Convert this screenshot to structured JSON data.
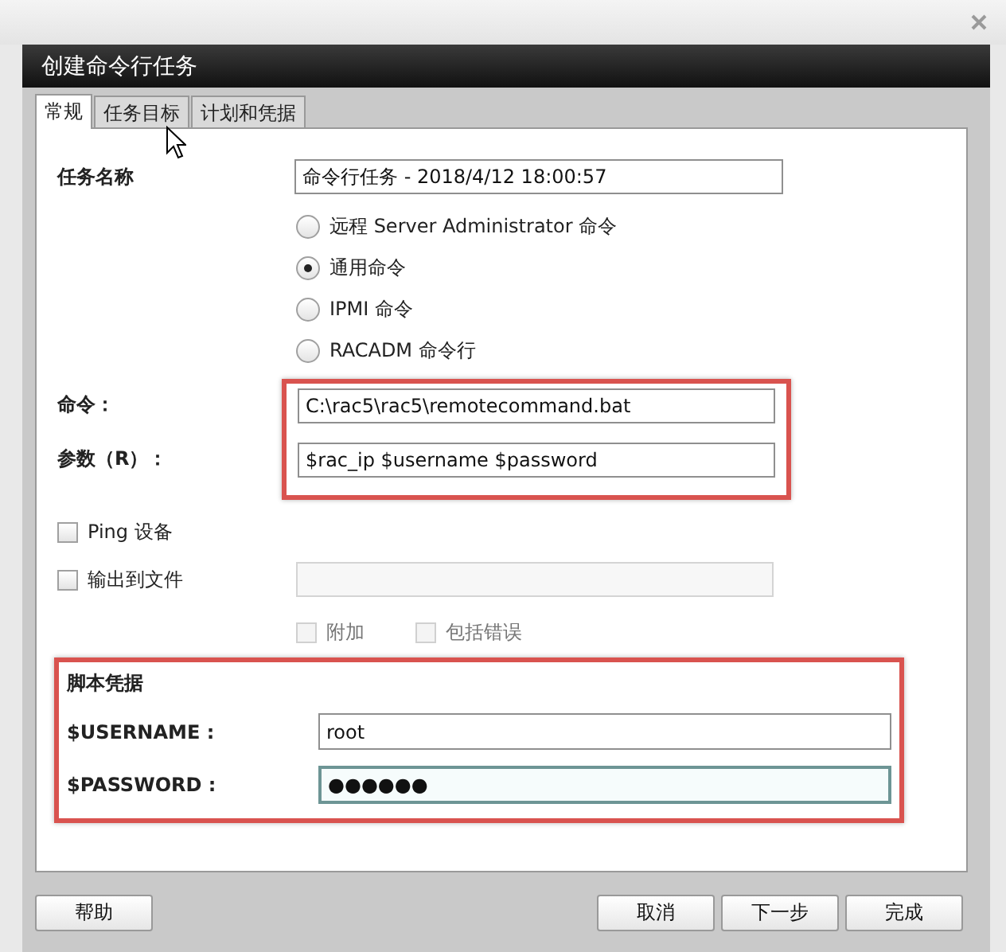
{
  "window": {
    "title": "创建命令行任务"
  },
  "tabs": [
    {
      "label": "常规",
      "selected": true
    },
    {
      "label": "任务目标",
      "selected": false
    },
    {
      "label": "计划和凭据",
      "selected": false
    }
  ],
  "task_name": {
    "label": "任务名称",
    "value": "命令行任务 - 2018/4/12 18:00:57"
  },
  "command_types": [
    {
      "label": "远程 Server Administrator 命令",
      "selected": false
    },
    {
      "label": "通用命令",
      "selected": true
    },
    {
      "label": "IPMI 命令",
      "selected": false
    },
    {
      "label": "RACADM 命令行",
      "selected": false
    }
  ],
  "command": {
    "label": "命令：",
    "value": "C:\\rac5\\rac5\\remotecommand.bat"
  },
  "arguments": {
    "label": "参数（R）：",
    "value": "$rac_ip $username $password"
  },
  "options": [
    {
      "label": "Ping 设备",
      "checked": false,
      "disabled": false
    },
    {
      "label": "输出到文件",
      "checked": false,
      "disabled": false
    }
  ],
  "output_file": {
    "disabled": true
  },
  "output_options": [
    {
      "label": "附加",
      "checked": false,
      "disabled": true
    },
    {
      "label": "包括错误",
      "checked": false,
      "disabled": true
    }
  ],
  "script_credentials": {
    "title": "脚本凭据",
    "fields": [
      {
        "label": "$USERNAME :",
        "value": "root",
        "focused": false
      },
      {
        "label": "$PASSWORD :",
        "value": "●●●●●●",
        "focused": true
      }
    ]
  },
  "footer": {
    "left": [
      {
        "label": "帮助"
      }
    ],
    "right": [
      {
        "label": "取消"
      },
      {
        "label": "下一步"
      },
      {
        "label": "完成"
      }
    ]
  }
}
